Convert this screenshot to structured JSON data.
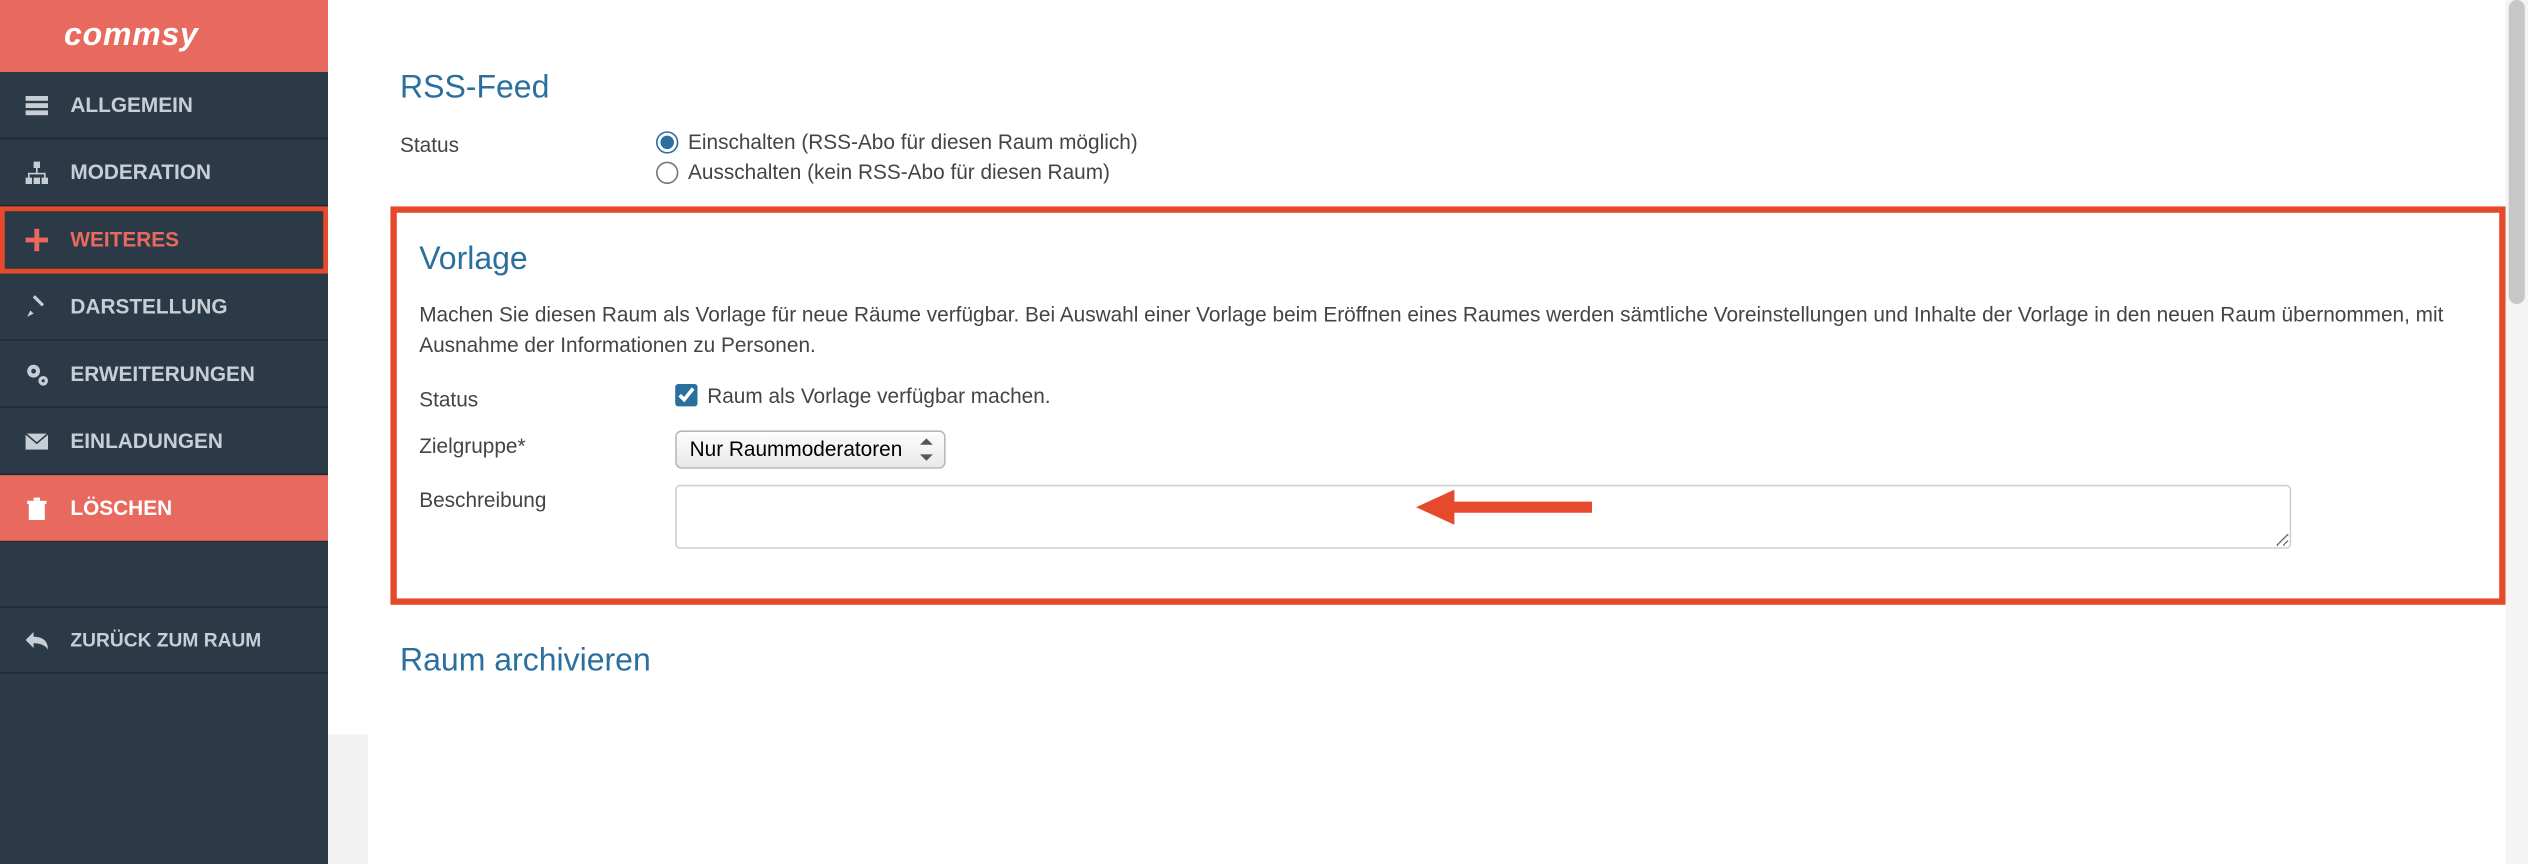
{
  "brand": {
    "logo_text": "commsy"
  },
  "sidebar": {
    "items": [
      {
        "label": "ALLGEMEIN",
        "icon": "server-icon"
      },
      {
        "label": "MODERATION",
        "icon": "sitemap-icon"
      },
      {
        "label": "WEITERES",
        "icon": "plus-icon",
        "active": true
      },
      {
        "label": "DARSTELLUNG",
        "icon": "brush-icon"
      },
      {
        "label": "ERWEITERUNGEN",
        "icon": "gears-icon"
      },
      {
        "label": "EINLADUNGEN",
        "icon": "envelope-icon"
      },
      {
        "label": "LÖSCHEN",
        "icon": "trash-icon",
        "danger": true
      }
    ],
    "back_label": "ZURÜCK ZUM RAUM"
  },
  "rss": {
    "title": "RSS-Feed",
    "status_label": "Status",
    "option_on": "Einschalten (RSS-Abo für diesen Raum möglich)",
    "option_off": "Ausschalten (kein RSS-Abo für diesen Raum)",
    "selected": "on"
  },
  "vorlage": {
    "title": "Vorlage",
    "description": "Machen Sie diesen Raum als Vorlage für neue Räume verfügbar. Bei Auswahl einer Vorlage beim Eröffnen eines Raumes werden sämtliche Voreinstellungen und Inhalte der Vorlage in den neuen Raum übernommen, mit Ausnahme der Informationen zu Personen.",
    "status_label": "Status",
    "checkbox_label": "Raum als Vorlage verfügbar machen.",
    "checkbox_checked": true,
    "zielgruppe_label": "Zielgruppe*",
    "zielgruppe_value": "Nur Raummoderatoren",
    "beschreibung_label": "Beschreibung",
    "beschreibung_value": ""
  },
  "archive": {
    "title": "Raum archivieren"
  },
  "colors": {
    "accent": "#e86a5e",
    "heading": "#2a6f9e",
    "sidebar_bg": "#2c3a47",
    "highlight": "#e44a2b"
  }
}
